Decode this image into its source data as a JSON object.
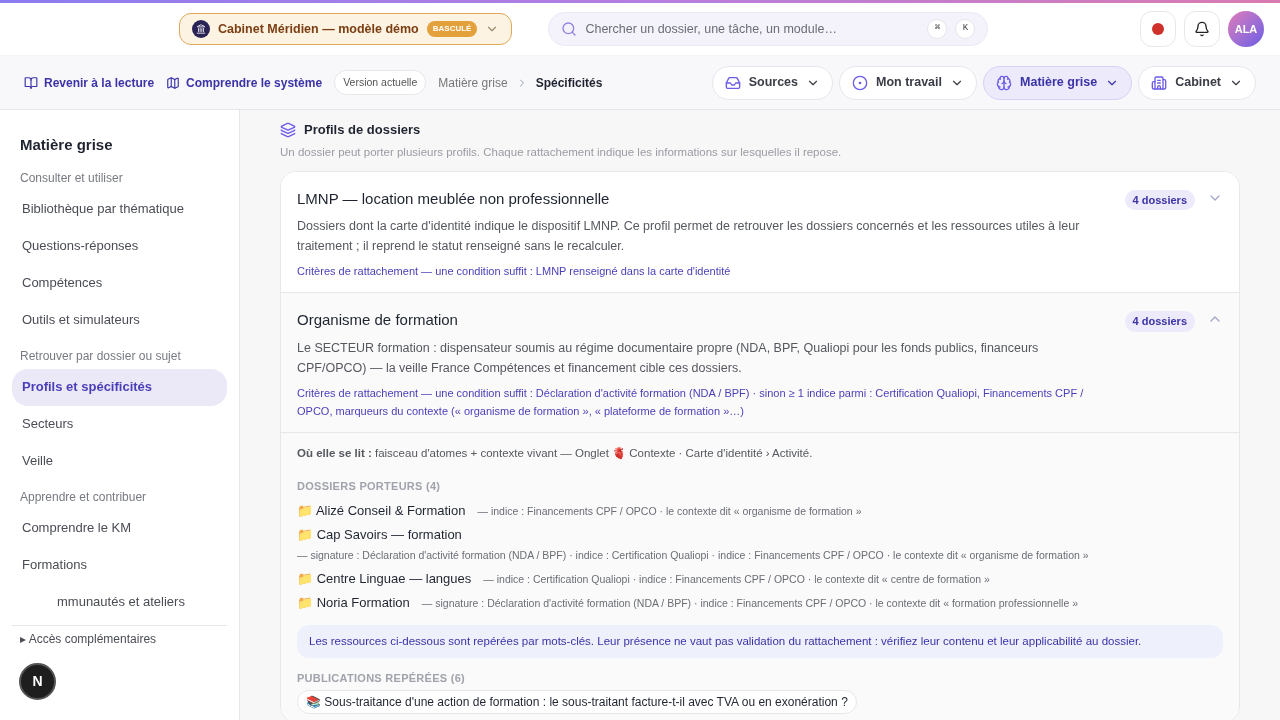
{
  "header": {
    "workspace": {
      "name": "Cabinet Méridien — modèle démo",
      "badge": "BASCULÉ"
    },
    "search": {
      "placeholder": "Chercher un dossier, une tâche, un module…",
      "keys": [
        "⌘",
        "K"
      ]
    },
    "recording": true,
    "avatar": "ALA"
  },
  "subnav": {
    "links": [
      {
        "label": "Revenir à la lecture"
      },
      {
        "label": "Comprendre le système"
      }
    ],
    "version": "Version actuelle",
    "breadcrumb": [
      "Matière grise",
      "Spécificités"
    ],
    "menus": [
      {
        "label": "Sources",
        "selected": false
      },
      {
        "label": "Mon travail",
        "selected": false
      },
      {
        "label": "Matière grise",
        "selected": true
      },
      {
        "label": "Cabinet",
        "selected": false
      }
    ]
  },
  "sidebar": {
    "title": "Matière grise",
    "groups": [
      {
        "label": "Consulter et utiliser",
        "items": [
          {
            "label": "Bibliothèque par thématique",
            "selected": false
          },
          {
            "label": "Questions-réponses",
            "selected": false
          },
          {
            "label": "Compétences",
            "selected": false
          },
          {
            "label": "Outils et simulateurs",
            "selected": false
          }
        ]
      },
      {
        "label": "Retrouver par dossier ou sujet",
        "items": [
          {
            "label": "Profils et spécificités",
            "selected": true
          },
          {
            "label": "Secteurs",
            "selected": false
          },
          {
            "label": "Veille",
            "selected": false
          }
        ]
      },
      {
        "label": "Apprendre et contribuer",
        "items": [
          {
            "label": "Comprendre le KM",
            "selected": false
          },
          {
            "label": "Formations",
            "selected": false
          },
          {
            "label": "mmunautés et ateliers",
            "selected": false
          }
        ]
      }
    ],
    "more": {
      "marker": "▸",
      "label": "Accès complémentaires"
    }
  },
  "section": {
    "title": "Profils de dossiers",
    "subtitle": "Un dossier peut porter plusieurs profils. Chaque rattachement indique les informations sur lesquelles il repose.",
    "profiles": [
      {
        "title": "LMNP — location meublée non professionnelle",
        "count": "4 dossiers",
        "expanded": false,
        "description": "Dossiers dont la carte d'identité indique le dispositif LMNP. Ce profil permet de retrouver les dossiers concernés et les ressources utiles à leur traitement ; il reprend le statut renseigné sans le recalculer.",
        "criteria": "Critères de rattachement — une condition suffit : LMNP renseigné dans la carte d'identité"
      },
      {
        "title": "Organisme de formation",
        "count": "4 dossiers",
        "expanded": true,
        "description": "Le SECTEUR formation : dispensateur soumis au régime documentaire propre (NDA, BPF, Qualiopi pour les fonds publics, financeurs CPF/OPCO) — la veille France Compétences et financement cible ces dossiers.",
        "criteria": "Critères de rattachement — une condition suffit : Déclaration d'activité formation (NDA / BPF) · sinon ≥ 1 indice parmi : Certification Qualiopi, Financements CPF / OPCO, marqueurs du contexte (« organisme de formation », « plateforme de formation »…)",
        "reading": "**Où elle se lit :** faisceau d'atomes + contexte vivant — Onglet 🫀 Contexte · Carte d'identité › Activité.",
        "dossiers_title": "DOSSIERS PORTEURS (4)",
        "dossiers": [
          {
            "icon": "📁",
            "name": "Alizé Conseil & Formation",
            "detail": "— indice : Financements CPF / OPCO · le contexte dit « organisme de formation »"
          },
          {
            "icon": "📁",
            "name": "Cap Savoirs — formation",
            "detail": "— signature : Déclaration d'activité formation (NDA / BPF) · indice : Certification Qualiopi · indice : Financements CPF / OPCO · le contexte dit « organisme de formation »"
          },
          {
            "icon": "📁",
            "name": "Centre Linguae — langues",
            "detail": "— indice : Certification Qualiopi · indice : Financements CPF / OPCO · le contexte dit « centre de formation »"
          },
          {
            "icon": "📁",
            "name": "Noria Formation",
            "detail": "— signature : Déclaration d'activité formation (NDA / BPF) · indice : Financements CPF / OPCO · le contexte dit « formation professionnelle »"
          }
        ],
        "notice": "Les ressources ci-dessous sont repérées par mots-clés. Leur présence ne vaut pas validation du rattachement : vérifiez leur contenu et leur applicabilité au dossier.",
        "publications_title": "PUBLICATIONS REPÉRÉES (6)",
        "publications": [
          "📚 Sous-traitance d'une action de formation : le sous-traitant facture-t-il avec TVA ou en exonération ?"
        ]
      }
    ]
  },
  "dev_badge": "N"
}
